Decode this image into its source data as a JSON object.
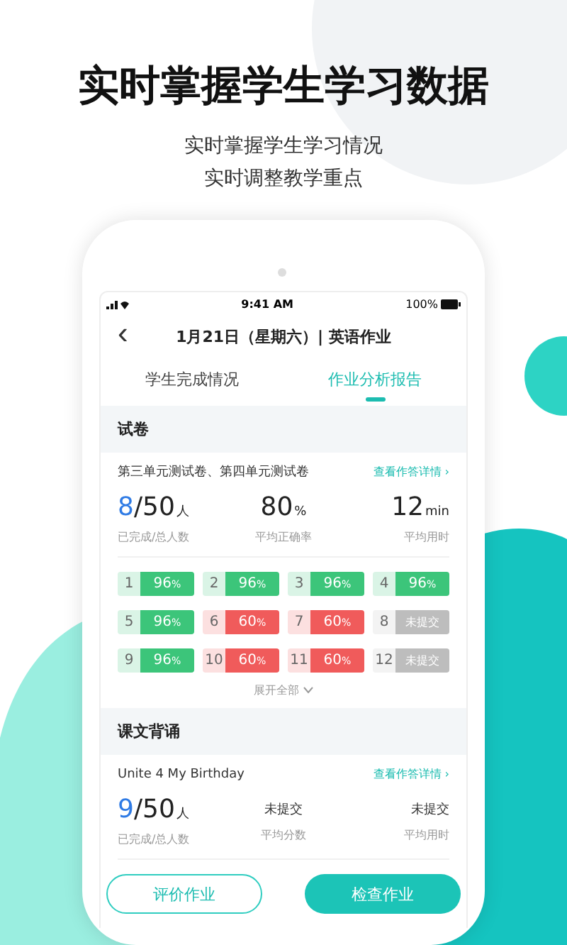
{
  "headline": "实时掌握学生学习数据",
  "subtitle_lines": [
    "实时掌握学生学习情况",
    "实时调整教学重点"
  ],
  "status_bar": {
    "time": "9:41 AM",
    "battery": "100%"
  },
  "nav": {
    "back": "‹",
    "title": "1月21日（星期六）| 英语作业"
  },
  "tabs": [
    {
      "label": "学生完成情况",
      "selected": false
    },
    {
      "label": "作业分析报告",
      "selected": true
    }
  ],
  "sections": [
    {
      "title": "试卷",
      "item_title": "第三单元测试卷、第四单元测试卷",
      "detail_link": "查看作答详情 ›",
      "stats": [
        {
          "kind": "number",
          "accent": "8",
          "main": "/50",
          "unit": "人",
          "label": "已完成/总人数"
        },
        {
          "kind": "number",
          "main": "80",
          "unit": "%",
          "label": "平均正确率"
        },
        {
          "kind": "number",
          "main": "12",
          "unit": "min",
          "label": "平均用时"
        }
      ],
      "questions": [
        {
          "number": "1",
          "value": "96",
          "unit": "%",
          "color": "#3cc57a"
        },
        {
          "number": "2",
          "value": "96",
          "unit": "%",
          "color": "#3cc57a"
        },
        {
          "number": "3",
          "value": "96",
          "unit": "%",
          "color": "#3cc57a"
        },
        {
          "number": "4",
          "value": "96",
          "unit": "%",
          "color": "#3cc57a"
        },
        {
          "number": "5",
          "value": "96",
          "unit": "%",
          "color": "#3cc57a"
        },
        {
          "number": "6",
          "value": "60",
          "unit": "%",
          "color": "#f05b5b"
        },
        {
          "number": "7",
          "value": "60",
          "unit": "%",
          "color": "#f05b5b"
        },
        {
          "number": "8",
          "value": "未提交",
          "color": "#bdbdbd"
        },
        {
          "number": "9",
          "value": "96",
          "unit": "%",
          "color": "#3cc57a"
        },
        {
          "number": "10",
          "value": "60",
          "unit": "%",
          "color": "#f05b5b"
        },
        {
          "number": "11",
          "value": "60",
          "unit": "%",
          "color": "#f05b5b"
        },
        {
          "number": "12",
          "value": "未提交",
          "color": "#bdbdbd"
        }
      ],
      "expand": "展开全部"
    },
    {
      "title": "课文背诵",
      "item_title": "Unite 4 My Birthday",
      "detail_link": "查看作答详情 ›",
      "stats": [
        {
          "kind": "number",
          "accent": "9",
          "main": "/50",
          "unit": "人",
          "label": "已完成/总人数"
        },
        {
          "kind": "text",
          "main": "未提交",
          "label": "平均分数"
        },
        {
          "kind": "text",
          "main": "未提交",
          "label": "平均用时"
        }
      ]
    }
  ],
  "buttons": [
    {
      "label": "评价作业",
      "kind": "outline"
    },
    {
      "label": "检查作业",
      "kind": "filled"
    }
  ]
}
